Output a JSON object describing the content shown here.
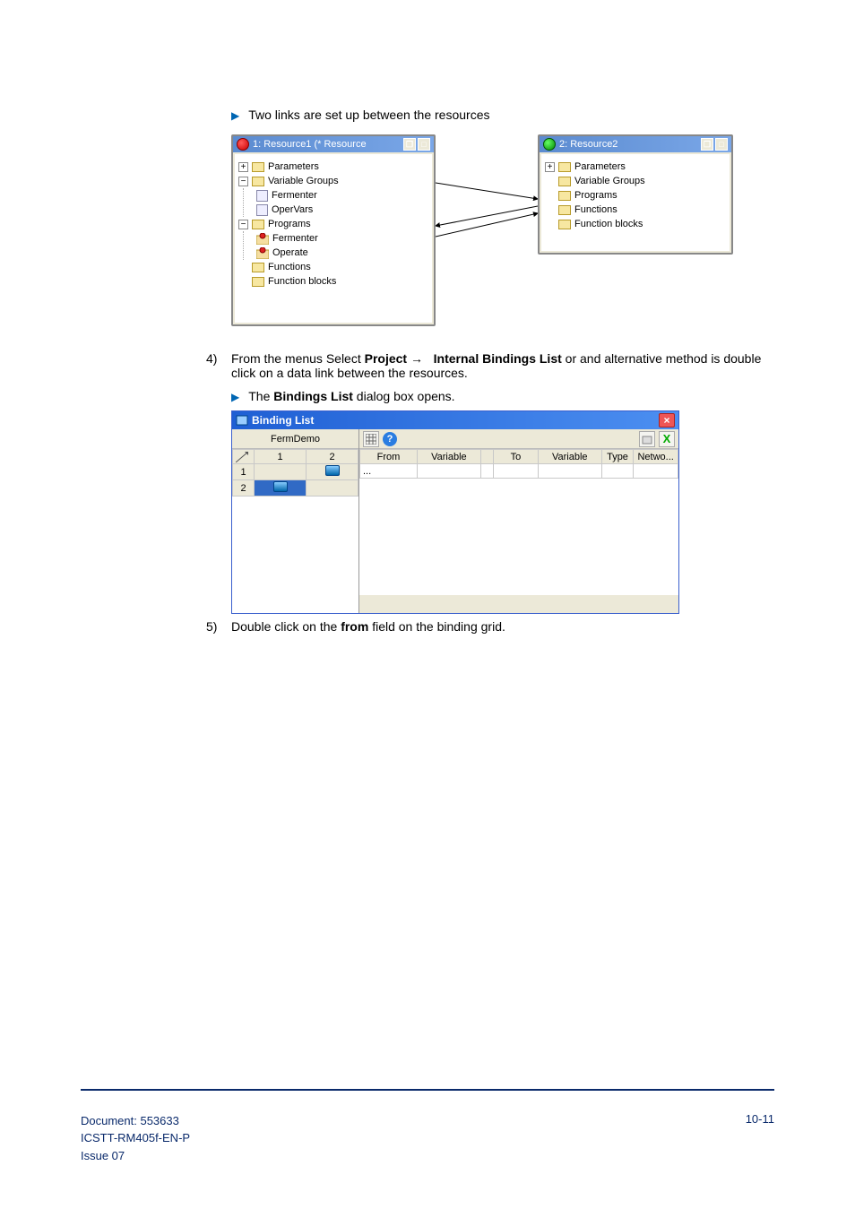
{
  "bullets": {
    "line1": "Two links are set up between the resources",
    "bindings_opens_pre": "The ",
    "bindings_opens_bold": "Bindings List",
    "bindings_opens_post": " dialog box opens."
  },
  "steps": {
    "s4_num": "4)",
    "s4_pre": "From the menus Select ",
    "s4_project": "Project",
    "s4_arrow": " → ",
    "s4_ibl": "Internal Bindings List",
    "s4_post": " or and alternative method is double click on a data link between the resources.",
    "s5_num": "5)",
    "s5_pre": "Double click on the ",
    "s5_bold": "from",
    "s5_post": " field on the binding grid."
  },
  "win1": {
    "title": "1: Resource1 (* Resource",
    "nodes": {
      "parameters": "Parameters",
      "vgroups": "Variable Groups",
      "fermenter": "Fermenter",
      "opervars": "OperVars",
      "programs": "Programs",
      "prog_fermenter": "Fermenter",
      "prog_operate": "Operate",
      "functions": "Functions",
      "fblocks": "Function blocks"
    }
  },
  "win2": {
    "title": "2: Resource2",
    "nodes": {
      "parameters": "Parameters",
      "vgroups": "Variable Groups",
      "programs": "Programs",
      "functions": "Functions",
      "fblocks": "Function blocks"
    }
  },
  "dialog": {
    "title": "Binding List",
    "project": "FermDemo",
    "cols_left": {
      "c0": "",
      "c1": "1",
      "c2": "2"
    },
    "rows_left": {
      "r1": "1",
      "r2": "2"
    },
    "cols_right": {
      "from": "From",
      "var1": "Variable",
      "to": "To",
      "var2": "Variable",
      "type": "Type",
      "netwo": "Netwo..."
    },
    "cell_from": "..."
  },
  "footer": {
    "doc": "Document: 553633",
    "ref": "ICSTT-RM405f-EN-P",
    "issue": "Issue 07",
    "page": "10-11"
  }
}
